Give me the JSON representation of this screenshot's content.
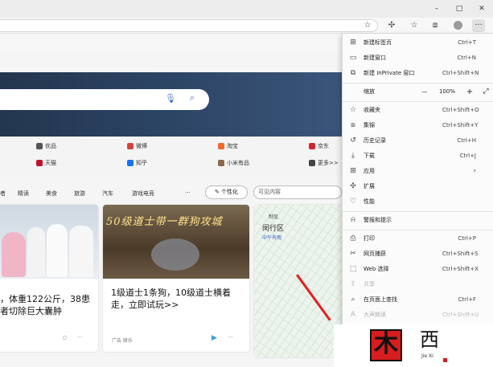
{
  "browser": {
    "window_controls": {
      "minimize": "–",
      "maximize": "□",
      "close": "✕"
    },
    "toolbar_icons": [
      "favorite-add-icon",
      "extensions-icon",
      "favorites-icon",
      "collections-icon",
      "profile-icon",
      "menu-icon"
    ]
  },
  "quick_links": [
    {
      "label": "优品",
      "color": "#555555"
    },
    {
      "label": "微博",
      "color": "#d9413b"
    },
    {
      "label": "淘宝",
      "color": "#f0692e"
    },
    {
      "label": "京东",
      "color": "#d1262e"
    },
    {
      "label": "天猫",
      "color": "#c4112b"
    },
    {
      "label": "知乎",
      "color": "#1772f6"
    },
    {
      "label": "小米有品",
      "color": "#8a6a4a"
    },
    {
      "label": "更多>>",
      "color": "#444444"
    }
  ],
  "categories": [
    "者",
    "精读",
    "美食",
    "旅游",
    "汽车",
    "游戏电竞",
    "···"
  ],
  "personalize_label": "个性化",
  "visibility_label": "可见内容",
  "cards": [
    {
      "title": "，体重122公斤，38患者切除巨大囊肿",
      "source": ""
    },
    {
      "banner": "50级道士带一群狗攻城",
      "title": "1级道士1条狗，10级道士横着走，立即试玩>>",
      "source": "广告 原乐"
    },
    {
      "map_title": "制见",
      "map_sub": "闵行区",
      "map_tag": "中午有雨"
    }
  ],
  "menu": {
    "items": [
      {
        "icon": "new-tab-icon",
        "glyph": "⊞",
        "label": "新建标签页",
        "shortcut": "Ctrl+T",
        "disabled": false
      },
      {
        "icon": "new-window-icon",
        "glyph": "▭",
        "label": "新建窗口",
        "shortcut": "Ctrl+N",
        "disabled": false
      },
      {
        "icon": "inprivate-icon",
        "glyph": "⧉",
        "label": "新建 InPrivate 窗口",
        "shortcut": "Ctrl+Shift+N",
        "disabled": false
      },
      {
        "icon": "favorites-star-icon",
        "glyph": "☆",
        "label": "收藏夹",
        "shortcut": "Ctrl+Shift+O",
        "disabled": false
      },
      {
        "icon": "collections-icon",
        "glyph": "⧈",
        "label": "集锦",
        "shortcut": "Ctrl+Shift+Y",
        "disabled": false
      },
      {
        "icon": "history-icon",
        "glyph": "↺",
        "label": "历史记录",
        "shortcut": "Ctrl+H",
        "disabled": false
      },
      {
        "icon": "download-icon",
        "glyph": "⤓",
        "label": "下载",
        "shortcut": "Ctrl+J",
        "disabled": false
      },
      {
        "icon": "apps-icon",
        "glyph": "⊞",
        "label": "应用",
        "shortcut": "",
        "disabled": false,
        "submenu": true
      },
      {
        "icon": "extensions-icon",
        "glyph": "✣",
        "label": "扩展",
        "shortcut": "",
        "disabled": false
      },
      {
        "icon": "performance-icon",
        "glyph": "♡",
        "label": "性能",
        "shortcut": "",
        "disabled": false
      },
      {
        "icon": "alerts-icon",
        "glyph": "🔔",
        "label": "警报和提示",
        "shortcut": "",
        "disabled": false
      },
      {
        "icon": "print-icon",
        "glyph": "⎙",
        "label": "打印",
        "shortcut": "Ctrl+P",
        "disabled": false
      },
      {
        "icon": "screenshot-icon",
        "glyph": "✂",
        "label": "网页捕获",
        "shortcut": "Ctrl+Shift+S",
        "disabled": false
      },
      {
        "icon": "web-select-icon",
        "glyph": "⬚",
        "label": "Web 选择",
        "shortcut": "Ctrl+Shift+X",
        "disabled": false
      },
      {
        "icon": "share-icon",
        "glyph": "⇪",
        "label": "共享",
        "shortcut": "",
        "disabled": true
      },
      {
        "icon": "find-icon",
        "glyph": "⌕",
        "label": "在页面上查找",
        "shortcut": "Ctrl+F",
        "disabled": false
      },
      {
        "icon": "read-aloud-icon",
        "glyph": "A",
        "label": "大声朗读",
        "shortcut": "Ctrl+Shift+U",
        "disabled": true
      }
    ],
    "zoom": {
      "label": "缩放",
      "minus": "—",
      "value": "100%",
      "plus": "+",
      "fullscreen": "⤢"
    }
  },
  "watermark": {
    "char1": "木",
    "char2": "西",
    "sub": "Jie Xi"
  },
  "colors": {
    "accent": "#3a6cc4",
    "hero": "#2d4565",
    "watermark_red": "#d71d1d"
  }
}
